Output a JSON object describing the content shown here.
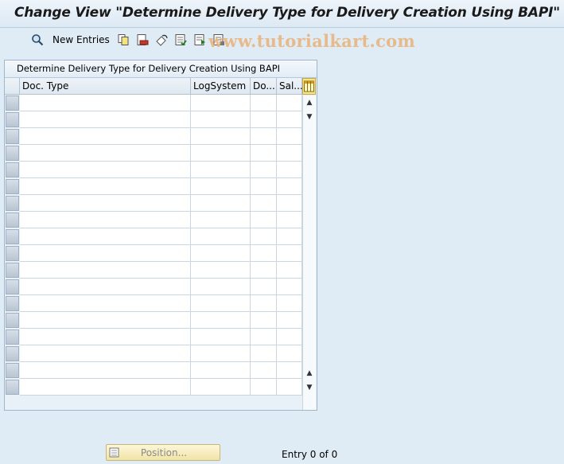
{
  "window": {
    "title": "Change View \"Determine Delivery Type for Delivery Creation Using BAPI\""
  },
  "toolbar": {
    "new_entries_label": "New Entries",
    "icons": [
      "display-change-icon",
      "copy-icon",
      "delete-icon",
      "undo-change-icon",
      "select-all-icon",
      "select-block-icon",
      "deselect-all-icon"
    ]
  },
  "watermark": {
    "text": "www.tutorialkart.com"
  },
  "table": {
    "title": "Determine Delivery Type for Delivery Creation Using BAPI",
    "columns": [
      "Doc. Type",
      "LogSystem",
      "Do...",
      "Sal..."
    ],
    "rows": [],
    "visible_empty_rows": 18
  },
  "footer": {
    "position_label": "Position...",
    "entry_text": "Entry 0 of 0"
  },
  "colors": {
    "background": "#dfebf5",
    "watermark": "#e9b27a"
  }
}
